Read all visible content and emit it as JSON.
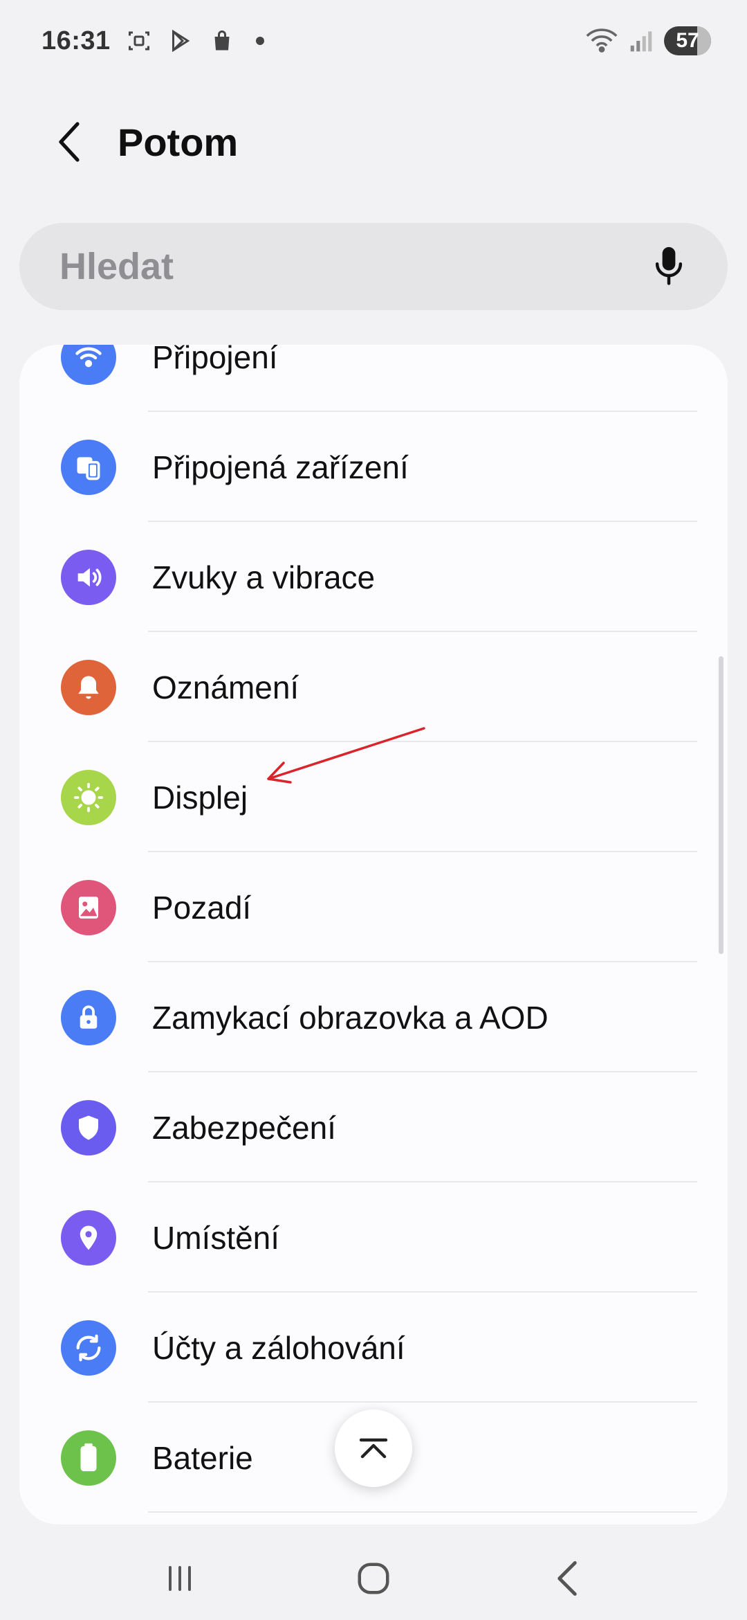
{
  "status_bar": {
    "time": "16:31",
    "battery": "57",
    "icons": [
      "screenshot-icon",
      "play-store-icon",
      "shopping-bag-icon",
      "notification-dot",
      "wifi-icon",
      "cell-signal-icon"
    ]
  },
  "header": {
    "title": "Potom"
  },
  "search": {
    "placeholder": "Hledat"
  },
  "settings_items": [
    {
      "label": "Připojení",
      "icon": "wifi-icon",
      "color": "#4a7cf5"
    },
    {
      "label": "Připojená zařízení",
      "icon": "connected-devices-icon",
      "color": "#4a7cf5"
    },
    {
      "label": "Zvuky a vibrace",
      "icon": "speaker-icon",
      "color": "#7a5cf0"
    },
    {
      "label": "Oznámení",
      "icon": "bell-icon",
      "color": "#e0643a"
    },
    {
      "label": "Displej",
      "icon": "sun-icon",
      "color": "#a8d64a"
    },
    {
      "label": "Pozadí",
      "icon": "wallpaper-icon",
      "color": "#e0567a"
    },
    {
      "label": "Zamykací obrazovka a AOD",
      "icon": "lock-icon",
      "color": "#4a7cf5"
    },
    {
      "label": "Zabezpečení",
      "icon": "shield-icon",
      "color": "#6b5cf0"
    },
    {
      "label": "Umístění",
      "icon": "location-pin-icon",
      "color": "#7a5cf0"
    },
    {
      "label": "Účty a zálohování",
      "icon": "sync-icon",
      "color": "#4a7cf5"
    },
    {
      "label": "Baterie",
      "icon": "battery-icon",
      "color": "#6cc24a"
    }
  ],
  "annotation": {
    "color": "#d8252c"
  }
}
